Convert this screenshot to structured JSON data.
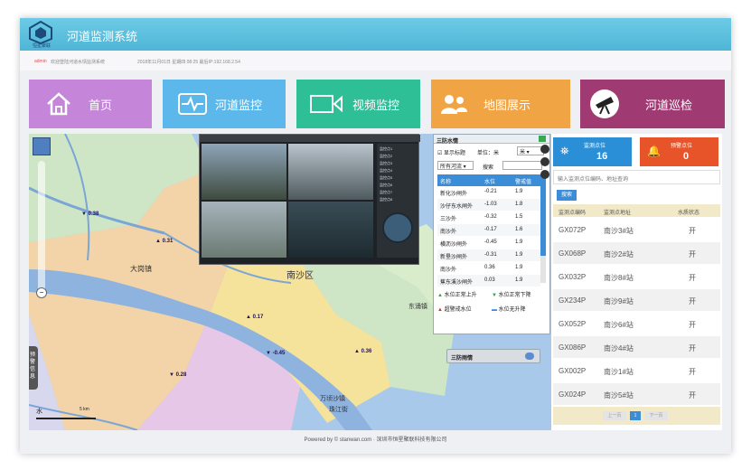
{
  "app": {
    "title": "河道监测系统",
    "logo_text": "恒星聚联"
  },
  "infobar": {
    "user": "admin",
    "welcome": "欢迎登陆河道水情监测系统",
    "datetime": "2018年11月01日 星期四 08:25 最后IP:192.168.2.54"
  },
  "nav": [
    {
      "label": "首页",
      "icon": "home-icon",
      "color": "#c585d8"
    },
    {
      "label": "河道监控",
      "icon": "pulse-monitor-icon",
      "color": "#5cb8ea"
    },
    {
      "label": "视频监控",
      "icon": "video-camera-icon",
      "color": "#2fbf97"
    },
    {
      "label": "地图展示",
      "icon": "users-map-icon",
      "color": "#f0a444"
    },
    {
      "label": "河道巡检",
      "icon": "telescope-icon",
      "color": "#a03a72"
    }
  ],
  "map": {
    "labels": [
      "南沙区",
      "大岗镇",
      "万顷沙镇",
      "珠江街",
      "东涌镇"
    ],
    "gauges": [
      "0.38",
      "0.31",
      "0.17",
      "-0.45",
      "0.36",
      "0.28"
    ],
    "scale": "5 km",
    "water_label": "水",
    "side_tab": "预警信息",
    "rain_panel": "三防雨情"
  },
  "water_panel": {
    "title": "三防水情",
    "show_label_text": "显示标题",
    "unit_label": "单位：米",
    "unit_value": "米",
    "filter_value": "所有河流",
    "search_label": "搜索",
    "columns": [
      "名称",
      "水位",
      "警戒值"
    ],
    "rows": [
      [
        "新化沙闸外",
        "-0.21",
        "1.9"
      ],
      [
        "沙仔东水闸外",
        "-1.03",
        "1.8"
      ],
      [
        "三沙外",
        "-0.32",
        "1.5"
      ],
      [
        "南沙外",
        "-0.17",
        "1.6"
      ],
      [
        "横沥沙闸外",
        "-0.45",
        "1.9"
      ],
      [
        "新垦沙闸外",
        "-0.31",
        "1.9"
      ],
      [
        "南沙外",
        "0.36",
        "1.9"
      ],
      [
        "蕉东溪沙闸外",
        "0.03",
        "1.9"
      ]
    ],
    "legend": [
      "水位正常上升",
      "水位正常下降",
      "超警戒水位",
      "水位无升降"
    ]
  },
  "video": {
    "side_items": [
      "监控点1",
      "监控点2",
      "监控点3",
      "监控点4",
      "监控点5",
      "监控点6",
      "监控点7",
      "监控点8"
    ]
  },
  "side": {
    "monitor_points_label": "监测点位",
    "monitor_points_value": "16",
    "alarm_points_label": "预警点位",
    "alarm_points_value": "0",
    "search_placeholder": "输入监测点位编码、地址查询",
    "search_button": "搜索",
    "columns": [
      "监测点编码",
      "监测点地址",
      "水质状态"
    ],
    "rows": [
      [
        "GX072P",
        "南沙3#站",
        "开"
      ],
      [
        "GX068P",
        "南沙2#站",
        "开"
      ],
      [
        "GX032P",
        "南沙8#站",
        "开"
      ],
      [
        "GX234P",
        "南沙9#站",
        "开"
      ],
      [
        "GX052P",
        "南沙6#站",
        "开"
      ],
      [
        "GX086P",
        "南沙4#站",
        "开"
      ],
      [
        "GX002P",
        "南沙1#站",
        "开"
      ],
      [
        "GX024P",
        "南沙5#站",
        "开"
      ]
    ],
    "pager": {
      "prev": "上一页",
      "current": "1",
      "next": "下一页"
    }
  },
  "footer": {
    "text": "Powered by © stanwan.com · 深圳市恒星聚联科技有限公司"
  },
  "colors": {
    "header": "#5bc0de",
    "blue_stat": "#2a8fd6",
    "orange_stat": "#e8542a"
  }
}
